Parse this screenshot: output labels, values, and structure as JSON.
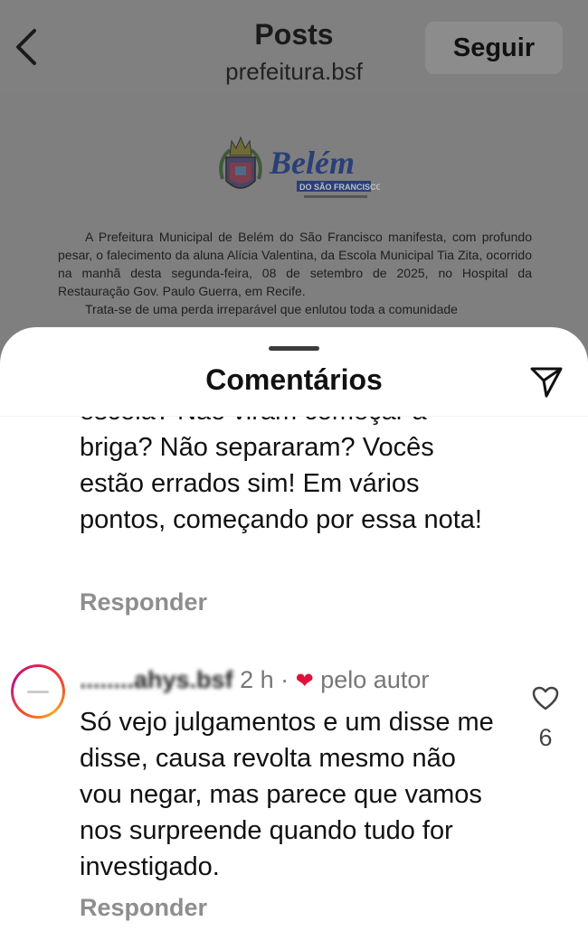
{
  "header": {
    "title": "Posts",
    "account": "prefeitura.bsf",
    "follow_label": "Seguir"
  },
  "post": {
    "logo": {
      "title": "Belém",
      "subtitle": "DO SÃO FRANCISCO"
    },
    "paragraph1": "A Prefeitura Municipal de Belém do São Francisco manifesta, com profundo pesar, o falecimento da aluna Alícia Valentina, da Escola Municipal Tia Zita, ocorrido na manhã desta segunda-feira, 08 de setembro de 2025, no Hospital da Restauração Gov. Paulo Guerra, em Recife.",
    "paragraph2": "Trata-se de uma perda irreparável que enlutou toda a comunidade"
  },
  "comments_sheet": {
    "title": "Comentários",
    "icons": {
      "share": "send-icon",
      "like": "heart-outline-icon",
      "author_like": "heart-filled-icon"
    },
    "comments": [
      {
        "text": "escola? Não viram começar a briga? Não separaram? Vocês estão errados sim! Em vários pontos, começando por essa nota!",
        "reply_label": "Responder"
      },
      {
        "username": "........ahys.bsf",
        "time": "2 h ·",
        "author_badge": "pelo autor",
        "text": "Só vejo julgamentos e um disse me disse, causa revolta mesmo não vou negar, mas parece que vamos nos surpreende quando tudo for investigado.",
        "reply_label": "Responder",
        "like_count": "6"
      }
    ]
  },
  "colors": {
    "overlay_gray": "#808080",
    "author_heart": "#e0103c",
    "muted_text": "#8e8e8e"
  }
}
